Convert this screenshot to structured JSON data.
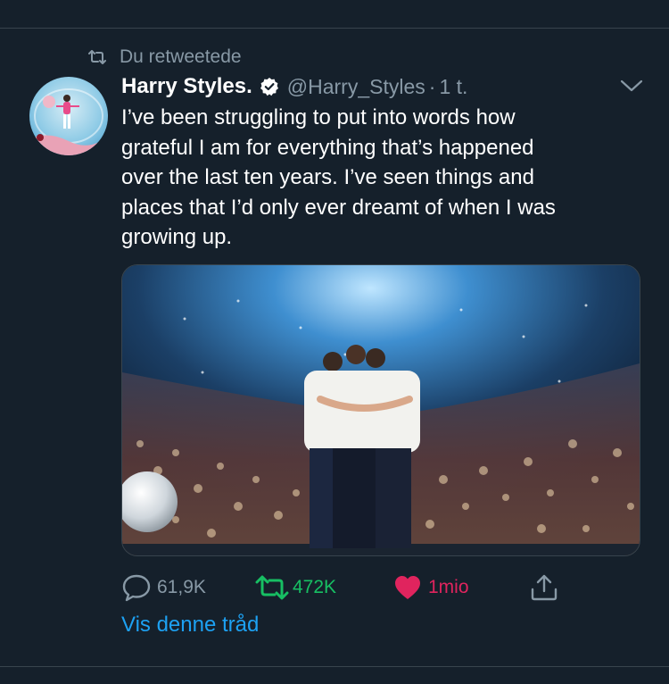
{
  "colors": {
    "background": "#15202b",
    "divider": "#38444d",
    "secondary_text": "#8899a6",
    "accent_blue": "#1da1f2",
    "retweet_green": "#17bf63",
    "like_red": "#e0245e"
  },
  "social_context": {
    "icon": "retweet-icon",
    "label": "Du retweetede"
  },
  "tweet": {
    "avatar_icon": "avatar",
    "author_name": "Harry Styles.",
    "verified_icon": "verified-badge-icon",
    "handle": "@Harry_Styles",
    "separator": "·",
    "timestamp": "1 t.",
    "menu_icon": "chevron-down-icon",
    "text_lines": [
      "I’ve been struggling to put into words how",
      "grateful I am for everything that’s happened",
      "over the last ten years. I’ve seen things and",
      "places that I’d only ever dreamt of when I was",
      "growing up."
    ]
  },
  "actions": {
    "reply": {
      "icon": "reply-icon",
      "count": "61,9K"
    },
    "retweet": {
      "icon": "retweet-icon",
      "count": "472K"
    },
    "like": {
      "icon": "heart-filled-icon",
      "count": "1mio"
    },
    "share": {
      "icon": "share-icon"
    }
  },
  "thread_link": "Vis denne tråd"
}
